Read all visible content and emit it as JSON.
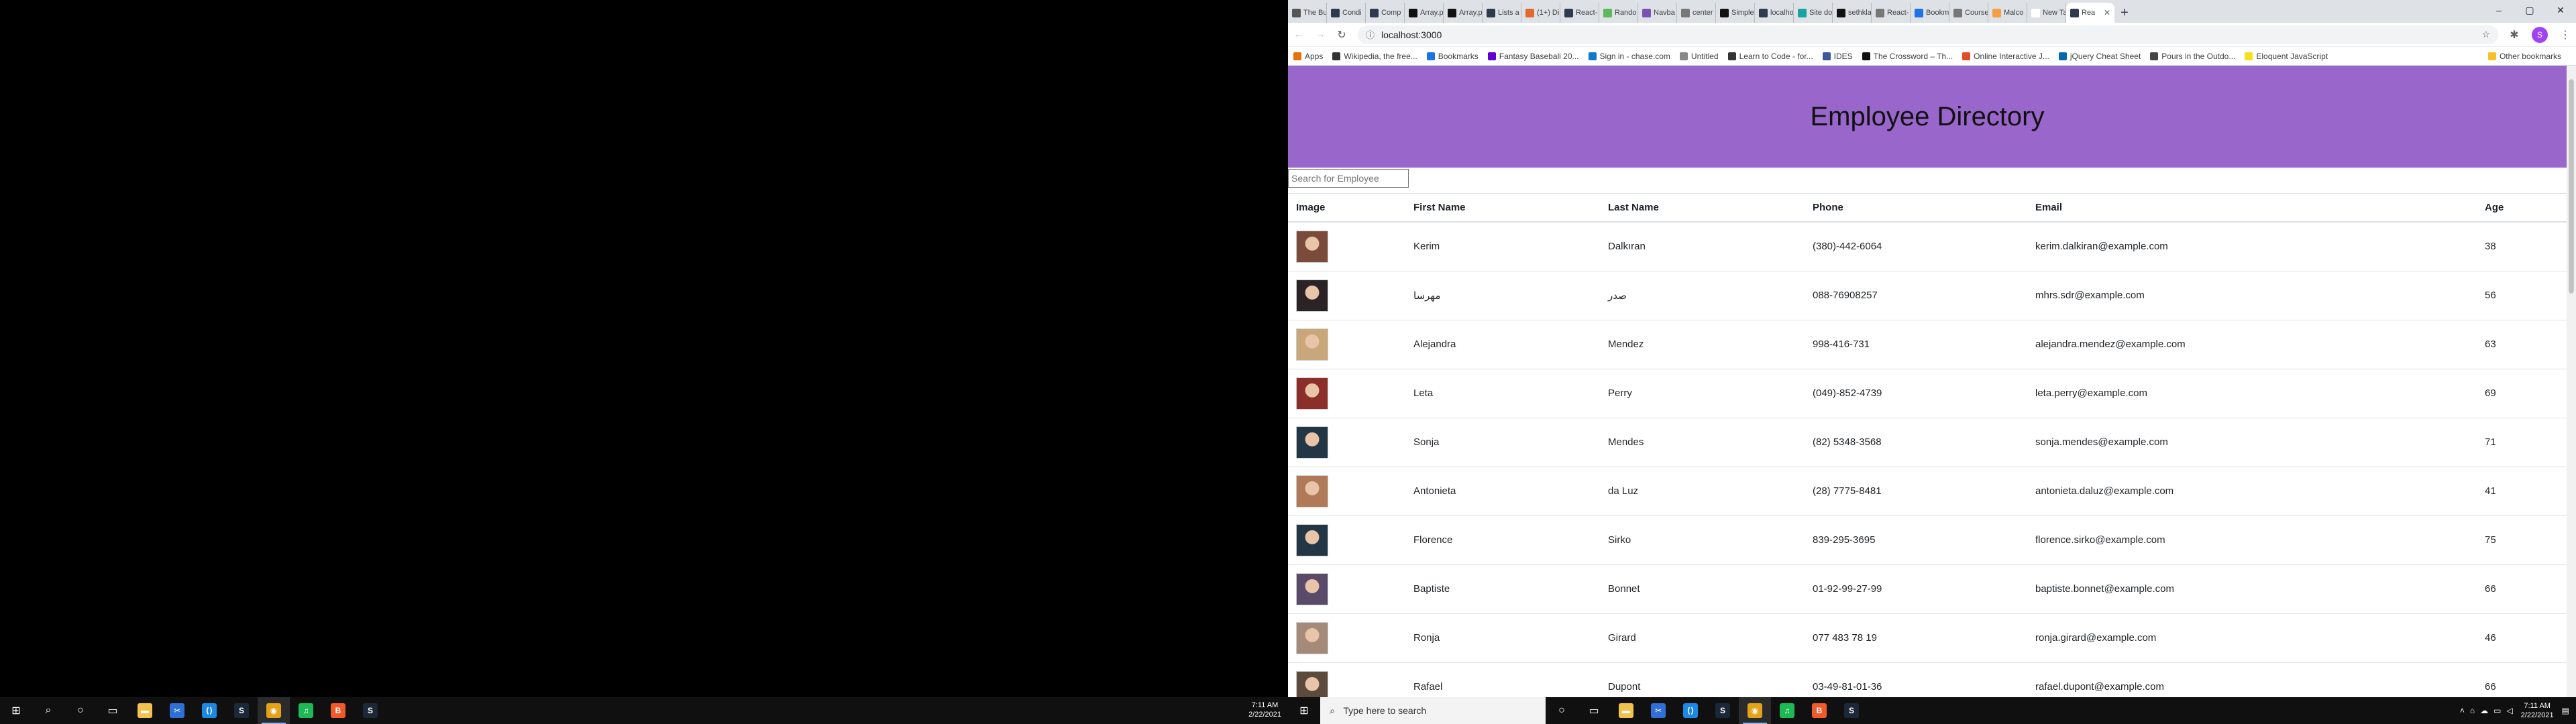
{
  "left_taskbar": {
    "apps": [
      {
        "name": "file-explorer",
        "color": "#f2c14e",
        "glyph": "▬"
      },
      {
        "name": "snipping",
        "color": "#2f6fd6",
        "glyph": "✂"
      },
      {
        "name": "vscode",
        "color": "#1e88e5",
        "glyph": "⟨⟩"
      },
      {
        "name": "steam",
        "color": "#1b2838",
        "glyph": "S"
      },
      {
        "name": "chrome",
        "color": "#e3a21a",
        "glyph": "◉",
        "active": true
      },
      {
        "name": "spotify",
        "color": "#1db954",
        "glyph": "♫"
      },
      {
        "name": "brave",
        "color": "#f05a28",
        "glyph": "B"
      },
      {
        "name": "steam2",
        "color": "#1b2838",
        "glyph": "S"
      }
    ],
    "time": "7:11 AM",
    "date": "2/22/2021"
  },
  "browser": {
    "tabs": [
      {
        "label": "The Bu",
        "color": "#555555"
      },
      {
        "label": "Condi",
        "color": "#2e3b4e"
      },
      {
        "label": "Comp",
        "color": "#2e3b4e"
      },
      {
        "label": "Array.p",
        "color": "#111111"
      },
      {
        "label": "Array.p",
        "color": "#111111"
      },
      {
        "label": "Lists a",
        "color": "#2e3b4e"
      },
      {
        "label": "(1+) Di",
        "color": "#e26a2c"
      },
      {
        "label": "React-",
        "color": "#2e3b4e"
      },
      {
        "label": "Rando",
        "color": "#5cb85c"
      },
      {
        "label": "Navba",
        "color": "#7952b3"
      },
      {
        "label": "center",
        "color": "#777777"
      },
      {
        "label": "Simple",
        "color": "#111111"
      },
      {
        "label": "localho",
        "color": "#2e3b4e"
      },
      {
        "label": "Site do",
        "color": "#1aa3a3"
      },
      {
        "label": "sethkla",
        "color": "#111111"
      },
      {
        "label": "React-",
        "color": "#777777"
      },
      {
        "label": "Bookm",
        "color": "#1a73e8"
      },
      {
        "label": "Course",
        "color": "#777777"
      },
      {
        "label": "Malco",
        "color": "#f4a040"
      },
      {
        "label": "New Tab",
        "color": "#ffffff"
      },
      {
        "label": "Rea",
        "color": "#2e3b4e",
        "active": true
      }
    ],
    "url": "localhost:3000",
    "profile_initial": "S"
  },
  "bookmarks": [
    {
      "label": "Apps",
      "color": "#e8710a"
    },
    {
      "label": "Wikipedia, the free...",
      "color": "#333333"
    },
    {
      "label": "Bookmarks",
      "color": "#1a73e8"
    },
    {
      "label": "Fantasy Baseball 20...",
      "color": "#6001d2"
    },
    {
      "label": "Sign in - chase.com",
      "color": "#117aca"
    },
    {
      "label": "Untitled",
      "color": "#888888"
    },
    {
      "label": "Learn to Code - for...",
      "color": "#333333"
    },
    {
      "label": "IDES",
      "color": "#3b5998"
    },
    {
      "label": "The Crossword – Th...",
      "color": "#111111"
    },
    {
      "label": "Online Interactive J...",
      "color": "#e44d26"
    },
    {
      "label": "jQuery Cheat Sheet",
      "color": "#0769ad"
    },
    {
      "label": "Pours in the Outdo...",
      "color": "#444444"
    },
    {
      "label": "Eloquent JavaScript",
      "color": "#f7df1e"
    }
  ],
  "bookmarks_other": "Other bookmarks",
  "app": {
    "title": "Employee Directory",
    "search_placeholder": "Search for Employee",
    "header_color": "#9966cc",
    "columns": [
      "Image",
      "First Name",
      "Last Name",
      "Phone",
      "Email",
      "Age"
    ],
    "employees": [
      {
        "first": "Kerim",
        "last": "Dalkıran",
        "phone": "(380)-442-6064",
        "email": "kerim.dalkiran@example.com",
        "age": "38",
        "tone": "#7a4a3a"
      },
      {
        "first": "مهرسا",
        "last": "صدر",
        "phone": "088-76908257",
        "email": "mhrs.sdr@example.com",
        "age": "56",
        "tone": "#2a2224"
      },
      {
        "first": "Alejandra",
        "last": "Mendez",
        "phone": "998-416-731",
        "email": "alejandra.mendez@example.com",
        "age": "63",
        "tone": "#c9a77a"
      },
      {
        "first": "Leta",
        "last": "Perry",
        "phone": "(049)-852-4739",
        "email": "leta.perry@example.com",
        "age": "69",
        "tone": "#8c2f2a"
      },
      {
        "first": "Sonja",
        "last": "Mendes",
        "phone": "(82) 5348-3568",
        "email": "sonja.mendes@example.com",
        "age": "71",
        "tone": "#233645"
      },
      {
        "first": "Antonieta",
        "last": "da Luz",
        "phone": "(28) 7775-8481",
        "email": "antonieta.daluz@example.com",
        "age": "41",
        "tone": "#b07a58"
      },
      {
        "first": "Florence",
        "last": "Sirko",
        "phone": "839-295-3695",
        "email": "florence.sirko@example.com",
        "age": "75",
        "tone": "#233645"
      },
      {
        "first": "Baptiste",
        "last": "Bonnet",
        "phone": "01-92-99-27-99",
        "email": "baptiste.bonnet@example.com",
        "age": "66",
        "tone": "#5a4a6a"
      },
      {
        "first": "Ronja",
        "last": "Girard",
        "phone": "077 483 78 19",
        "email": "ronja.girard@example.com",
        "age": "46",
        "tone": "#a58a7a"
      },
      {
        "first": "Rafael",
        "last": "Dupont",
        "phone": "03-49-81-01-36",
        "email": "rafael.dupont@example.com",
        "age": "66",
        "tone": "#5c4a3c"
      }
    ]
  },
  "right_taskbar": {
    "search_placeholder": "Type here to search",
    "apps": [
      {
        "name": "file-explorer",
        "color": "#f2c14e",
        "glyph": "▬"
      },
      {
        "name": "snipping",
        "color": "#2f6fd6",
        "glyph": "✂"
      },
      {
        "name": "vscode",
        "color": "#1e88e5",
        "glyph": "⟨⟩"
      },
      {
        "name": "steam",
        "color": "#1b2838",
        "glyph": "S"
      },
      {
        "name": "chrome",
        "color": "#e3a21a",
        "glyph": "◉",
        "active": true
      },
      {
        "name": "spotify",
        "color": "#1db954",
        "glyph": "♫"
      },
      {
        "name": "brave",
        "color": "#f05a28",
        "glyph": "B"
      },
      {
        "name": "steam2",
        "color": "#1b2838",
        "glyph": "S"
      }
    ],
    "time": "7:11 AM",
    "date": "2/22/2021"
  }
}
